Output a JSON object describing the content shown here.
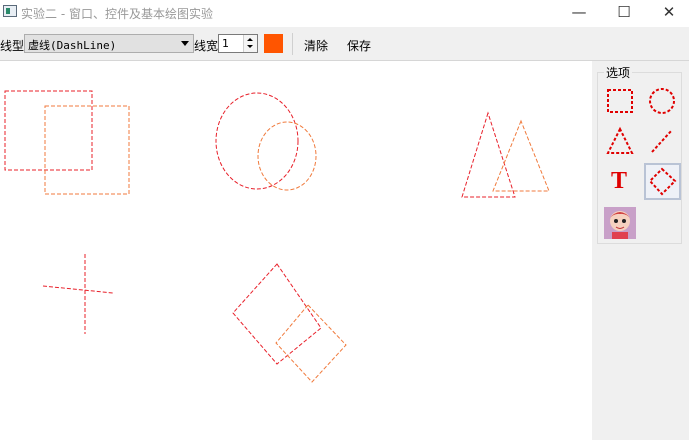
{
  "window": {
    "title": "实验二 - 窗口、控件及基本绘图实验",
    "minimize_glyph": "—",
    "maximize_glyph": "☐",
    "close_glyph": "✕"
  },
  "toolbar": {
    "line_type_label": "线型",
    "line_type_value": "虚线(DashLine)",
    "line_width_label": "线宽",
    "line_width_value": "1",
    "pen_color": "#ff5500",
    "clear_label": "清除",
    "save_label": "保存"
  },
  "options_panel": {
    "title": "选项",
    "tools": [
      {
        "name": "rectangle-icon"
      },
      {
        "name": "ellipse-icon"
      },
      {
        "name": "triangle-icon"
      },
      {
        "name": "line-icon"
      },
      {
        "name": "text-icon",
        "label": "T"
      },
      {
        "name": "diamond-icon",
        "selected": true
      },
      {
        "name": "image-icon"
      }
    ]
  },
  "colors": {
    "shape_red": "#e8202a",
    "shape_orange": "#f07a3c",
    "tool_red": "#e00000"
  }
}
